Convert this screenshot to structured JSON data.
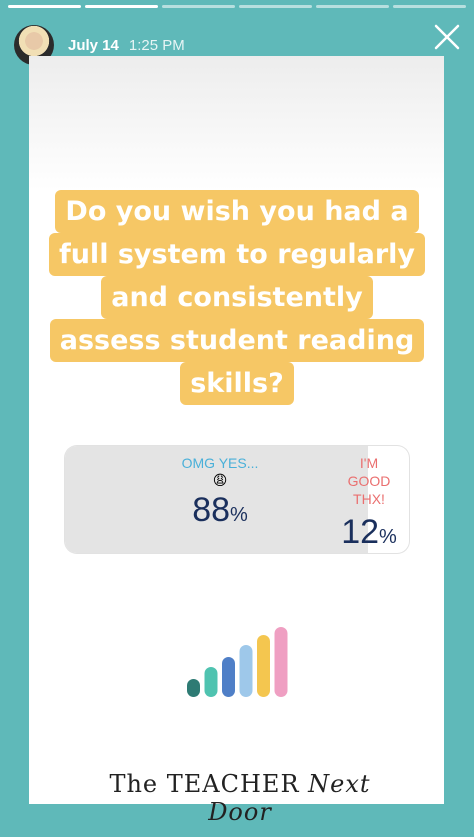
{
  "story": {
    "date": "July 14",
    "time": "1:25 PM",
    "progress_total": 6,
    "progress_done": 2
  },
  "question": {
    "lines": [
      "Do you wish you had a",
      "full system to regularly",
      "and consistently",
      "assess student reading",
      "skills?"
    ]
  },
  "poll": {
    "option1": {
      "label": "OMG YES...",
      "emoji": "😩",
      "percent": "88",
      "sign": "%"
    },
    "option2": {
      "label": "I'M GOOD THX!",
      "percent": "12",
      "sign": "%"
    },
    "fill_fraction": 0.88
  },
  "logo": {
    "text_main": "The TEACHER ",
    "text_script": "Next Door"
  },
  "colors": {
    "background_teal": "#5fb9b9",
    "question_yellow": "#f6c765",
    "bars": [
      "#2e7b74",
      "#4fc3b0",
      "#4f7fc7",
      "#9ec8ea",
      "#f4c64f",
      "#ef9fc2"
    ]
  }
}
